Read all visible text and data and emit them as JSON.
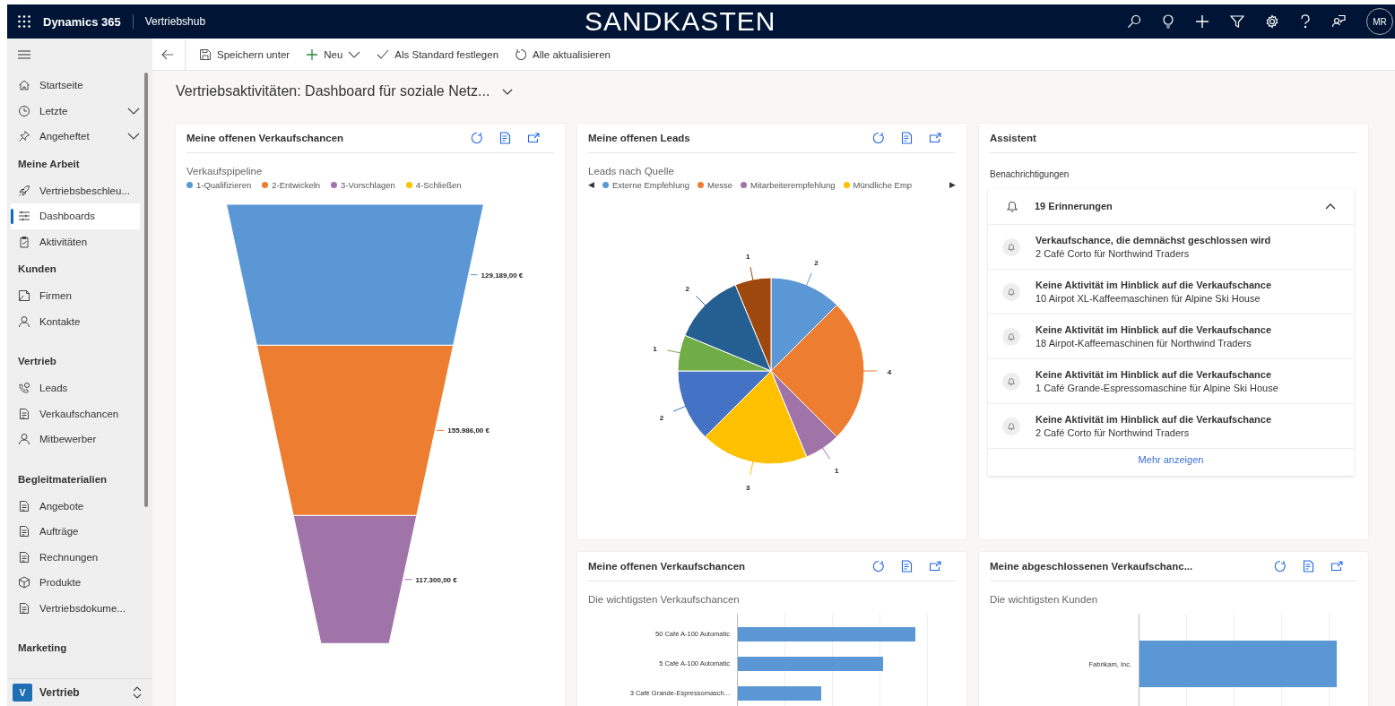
{
  "header": {
    "product": "Dynamics 365",
    "app": "Vertriebshub",
    "environment": "SANDKASTEN",
    "avatar": "MR"
  },
  "commands": [
    {
      "label": "Speichern unter"
    },
    {
      "label": "Neu",
      "has_menu": true
    },
    {
      "label": "Als Standard festlegen"
    },
    {
      "label": "Alle aktualisieren"
    }
  ],
  "sidebar": {
    "items": [
      {
        "label": "Startseite",
        "selected": false
      },
      {
        "label": "Letzte",
        "selected": false,
        "expanded": false
      },
      {
        "label": "Angeheftet",
        "selected": false,
        "expanded": false
      }
    ],
    "groups": [
      {
        "title": "Meine Arbeit",
        "items": [
          {
            "label": "Vertriebsbeschleu...",
            "selected": false
          },
          {
            "label": "Dashboards",
            "selected": true
          },
          {
            "label": "Aktivitäten",
            "selected": false
          }
        ]
      },
      {
        "title": "Kunden",
        "items": [
          {
            "label": "Firmen",
            "selected": false
          },
          {
            "label": "Kontakte",
            "selected": false
          }
        ]
      },
      {
        "title": "Vertrieb",
        "items": [
          {
            "label": "Leads",
            "selected": false
          },
          {
            "label": "Verkaufschancen",
            "selected": false
          },
          {
            "label": "Mitbewerber",
            "selected": false
          }
        ]
      },
      {
        "title": "Begleitmaterialien",
        "items": [
          {
            "label": "Angebote",
            "selected": false
          },
          {
            "label": "Aufträge",
            "selected": false
          },
          {
            "label": "Rechnungen",
            "selected": false
          },
          {
            "label": "Produkte",
            "selected": false
          },
          {
            "label": "Vertriebsdokume...",
            "selected": false
          }
        ]
      },
      {
        "title": "Marketing"
      }
    ],
    "area": {
      "letter": "V",
      "label": "Vertrieb"
    }
  },
  "dashboard_title": "Vertriebsaktivitäten: Dashboard für soziale Netz...",
  "funnel_card": {
    "title": "Meine offenen Verkaufschancen",
    "chart_title": "Verkaufspipeline",
    "legend": [
      {
        "label": "1-Qualifizieren",
        "color": "#5b97d5"
      },
      {
        "label": "2-Entwickeln",
        "color": "#ed7d31"
      },
      {
        "label": "3-Vorschlagen",
        "color": "#a074a8"
      },
      {
        "label": "4-Schließen",
        "color": "#ffc000"
      }
    ],
    "segments": [
      {
        "value_label": "129.189,00 €"
      },
      {
        "value_label": "155.986,00 €"
      },
      {
        "value_label": "117.300,00 €"
      }
    ]
  },
  "leads_card": {
    "title": "Meine offenen Leads",
    "chart_title": "Leads nach Quelle",
    "legend_prev": "◀",
    "legend_next": "▶",
    "legend": [
      {
        "label": "Externe Empfehlung",
        "color": "#5b97d5"
      },
      {
        "label": "Messe",
        "color": "#ed7d31"
      },
      {
        "label": "Mitarbeiterempfehlung",
        "color": "#a074a8"
      },
      {
        "label": "Mündliche Emp",
        "color": "#ffc000"
      }
    ],
    "chart_data": {
      "type": "pie",
      "values": [
        2,
        4,
        1,
        3,
        2,
        1,
        2,
        1
      ],
      "data_labels": true
    }
  },
  "assistant": {
    "title": "Assistent",
    "section": "Benachrichtigungen",
    "group_title": "19 Erinnerungen",
    "expanded": true,
    "items": [
      {
        "title": "Verkaufschance, die demnächst geschlossen wird",
        "detail": "2 Café Corto für Northwind Traders"
      },
      {
        "title": "Keine Aktivität im Hinblick auf die Verkaufschance",
        "detail": "10 Airpot XL-Kaffeemaschinen für Alpine Ski House"
      },
      {
        "title": "Keine Aktivität im Hinblick auf die Verkaufschance",
        "detail": "18 Airpot-Kaffeemaschinen für Northwind Traders"
      },
      {
        "title": "Keine Aktivität im Hinblick auf die Verkaufschance",
        "detail": "1 Café Grande-Espressomaschine für Alpine Ski House"
      },
      {
        "title": "Keine Aktivität im Hinblick auf die Verkaufschance",
        "detail": "2 Café Corto für Northwind Traders"
      }
    ],
    "more": "Mehr anzeigen"
  },
  "bar_cards": [
    {
      "title": "Meine offenen Verkaufschancen",
      "chart_title": "Die wichtigsten Verkaufschancen",
      "bars": [
        "50 Café A-100 Automatic",
        "5 Café A-100 Automatic",
        "3 Café Grande-Espressomasch..."
      ]
    },
    {
      "title": "Meine abgeschlossenen Verkaufschanc...",
      "chart_title": "Die wichtigsten Kunden",
      "bars": [
        "Fabrikam, Inc."
      ]
    }
  ]
}
